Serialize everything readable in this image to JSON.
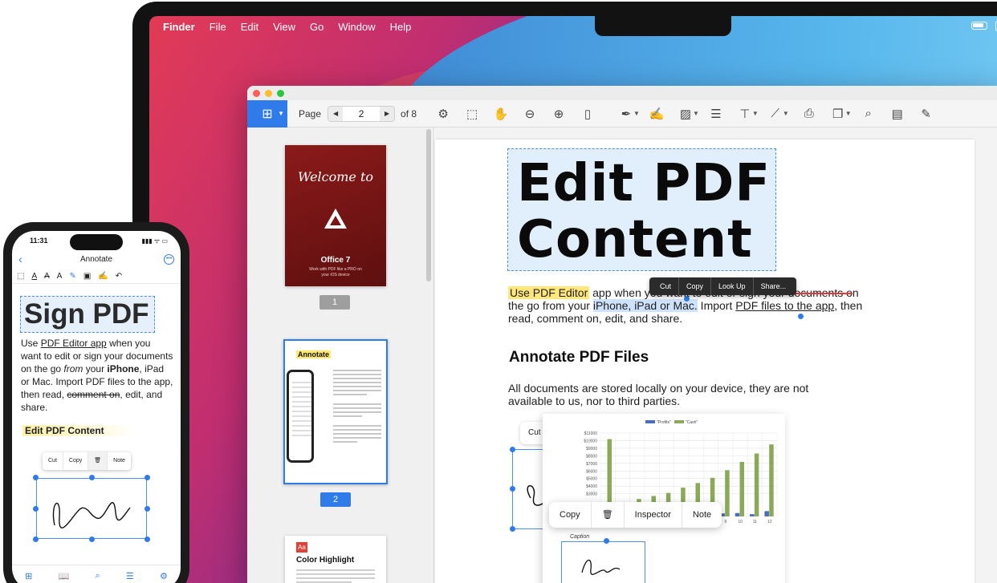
{
  "menubar": {
    "app": "Finder",
    "items": [
      "File",
      "Edit",
      "View",
      "Go",
      "Window",
      "Help"
    ]
  },
  "toolbar": {
    "page_label": "Page",
    "page_value": "2",
    "page_total": "of 8",
    "icons": [
      "settings-icon",
      "select-icon",
      "hand-icon",
      "zoom-out-icon",
      "zoom-in-icon",
      "sidebar-icon",
      "highlighter-icon",
      "signature-icon",
      "image-icon",
      "note-icon",
      "textbox-icon",
      "line-icon",
      "print-icon",
      "copy-icon",
      "search-icon",
      "document-icon",
      "form-icon"
    ]
  },
  "sidebar": {
    "thumb1": {
      "welcome": "Welcome to",
      "title": "Office 7",
      "subtitle": "Work with PDF like a PRO on your iOS device"
    },
    "page1": "1",
    "thumb2": {
      "heading": "Annotate"
    },
    "page2": "2",
    "thumb3": {
      "badge": "Aa",
      "heading": "Color Highlight"
    }
  },
  "doc": {
    "title_line1": "Edit PDF",
    "title_line2": "Content",
    "context_menu": [
      "Cut",
      "Copy",
      "Look Up",
      "Share..."
    ],
    "para": {
      "seg1": "Use PDF Editor",
      "seg2": " app when you want to edit or sign your ",
      "seg3": "documents o",
      "seg4": "n the go from your ",
      "seg5": "iPhone, iPad or Mac.",
      "seg6": " Import ",
      "seg7": "PDF files to the app",
      "seg8": ", then read, comment on, edit, and share."
    },
    "heading2": "Annotate PDF Files",
    "para2": "All documents are stored locally on your device, they are not available to us, nor to third parties.",
    "cut_stub": "Cut",
    "object_menu": [
      "Copy",
      "Inspector",
      "Note"
    ],
    "caption": "Caption"
  },
  "chart_data": {
    "type": "bar",
    "categories": [
      "",
      "",
      "",
      "",
      "",
      "",
      "",
      "",
      "9",
      "10",
      "11",
      "12"
    ],
    "series": [
      {
        "name": "\"Profits\"",
        "values": [
          0,
          0,
          0,
          0,
          0,
          0,
          0,
          0,
          400,
          450,
          300,
          700
        ]
      },
      {
        "name": "\"Cash\"",
        "values": [
          10200,
          1800,
          2300,
          2700,
          3100,
          3800,
          4400,
          5100,
          6100,
          7200,
          8300,
          9500
        ]
      }
    ],
    "colors": [
      "#4a6fb8",
      "#8aaa5a"
    ],
    "ylim": [
      0,
      11000
    ],
    "yticks": [
      "$11000",
      "$10000",
      "$9000",
      "$8000",
      "$7000",
      "$6000",
      "$5000",
      "$4000",
      "$3000"
    ],
    "legend": "top",
    "grid": true
  },
  "phone": {
    "time": "11:31",
    "status": "▮▮▮ ᯤ ▭",
    "nav_title": "Annotate",
    "tools": [
      "⬚",
      "A",
      "A",
      "A",
      "✎",
      "▣",
      "✍",
      "↶"
    ],
    "big_title": "Sign PDF",
    "para": {
      "s1": "Use ",
      "s2": "PDF Editor app",
      "s3": " when you want to edit or sign your documents on the go ",
      "s4": "from",
      "s5": " your ",
      "s6": "iPhone",
      "s7": ", iPad or Mac. Import PDF files to the app, then read, ",
      "s8": "comment on",
      "s9": ", edit, and share."
    },
    "edit_label": "Edit PDF Content",
    "context_menu": [
      "Cut",
      "Copy",
      "Note"
    ],
    "tabbar": [
      "grid-icon",
      "book-icon",
      "search-icon",
      "list-icon",
      "gear-icon"
    ]
  }
}
